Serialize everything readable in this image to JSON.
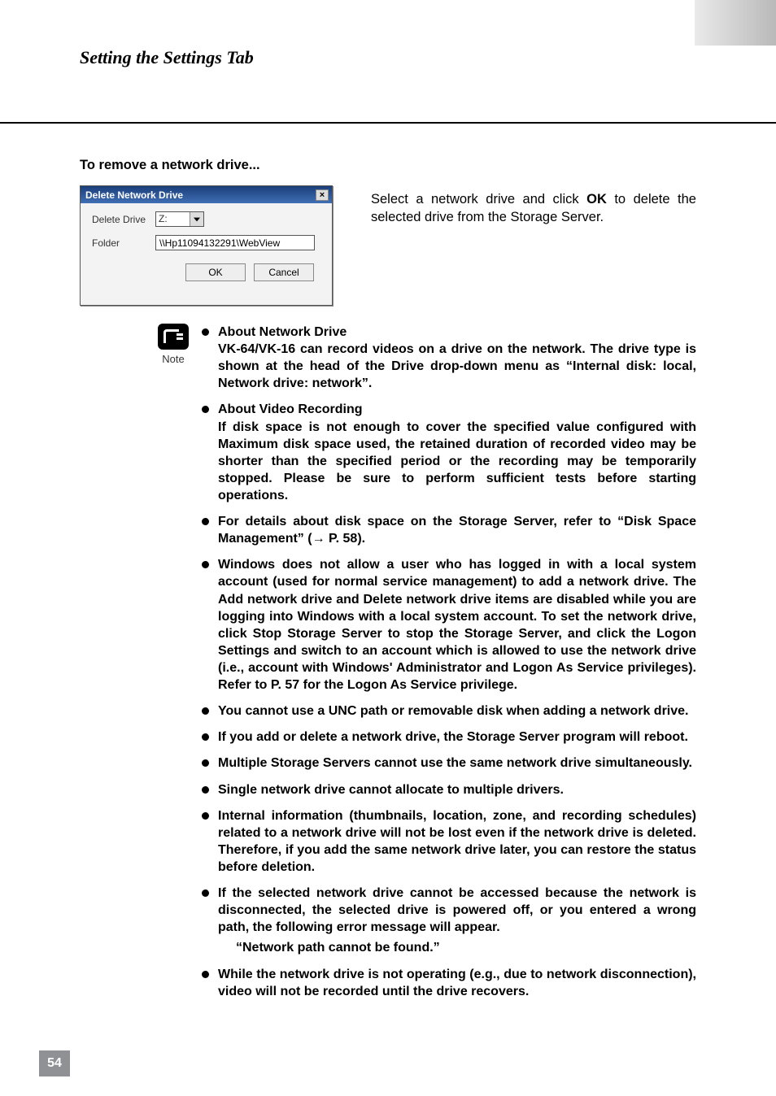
{
  "header": {
    "title": "Setting the Settings Tab"
  },
  "section": {
    "heading": "To remove a network drive..."
  },
  "dialog": {
    "title": "Delete Network Drive",
    "close_glyph": "×",
    "delete_drive_label": "Delete Drive",
    "drive_value": "Z:",
    "folder_label": "Folder",
    "folder_value": "\\\\Hp11094132291\\WebView",
    "ok_label": "OK",
    "cancel_label": "Cancel"
  },
  "side_text": {
    "pre": "Select a network drive and click ",
    "bold": "OK",
    "post": " to delete the selected drive from the Storage Server."
  },
  "note": {
    "label": "Note"
  },
  "bullets": [
    {
      "title": "About Network Drive",
      "body": "VK-64/VK-16 can record videos on a drive on the network. The drive type is shown at the head of the Drive drop-down menu as “Internal disk: local, Network drive: network”."
    },
    {
      "title": "About Video Recording",
      "body": "If disk space is not enough to cover the specified value configured with Maximum disk space used, the retained duration of recorded video may be shorter than the specified period or the recording may be temporarily stopped. Please be sure to perform sufficient tests before starting operations."
    },
    {
      "title": "For details about disk space on the Storage Server, refer to “Disk Space Management” (→ P. 58)."
    },
    {
      "title": "Windows does not allow a user who has logged in with a local system account (used for normal service management) to add a network drive. The Add network drive and Delete network drive items are disabled while you are logging into Windows with a local system account. To set the network drive, click Stop Storage Server to stop the Storage Server, and click the Logon Settings and switch to an account which is allowed to use the network drive (i.e., account with Windows' Administrator and Logon As Service privileges). Refer to P. 57 for the Logon As Service privilege."
    },
    {
      "title": "You cannot use a UNC path or removable disk when adding a network drive."
    },
    {
      "title": "If you add or delete a network drive, the Storage Server program will reboot."
    },
    {
      "title": "Multiple Storage Servers cannot use the same network drive simultaneously."
    },
    {
      "title": "Single network drive cannot allocate to multiple drivers."
    },
    {
      "title": "Internal information (thumbnails, location, zone, and recording schedules) related to a network drive will not be lost even if the network drive is deleted. Therefore, if you add the same network drive later, you can restore the status before deletion."
    },
    {
      "title": "If the selected network drive cannot be accessed because the network is disconnected, the selected drive is powered off, or you entered a wrong path, the following error message will appear.",
      "quote": "“Network path cannot be found.”"
    },
    {
      "title": "While the network drive is not operating (e.g., due to network disconnection), video will not be recorded until the drive recovers."
    }
  ],
  "page_number": "54"
}
